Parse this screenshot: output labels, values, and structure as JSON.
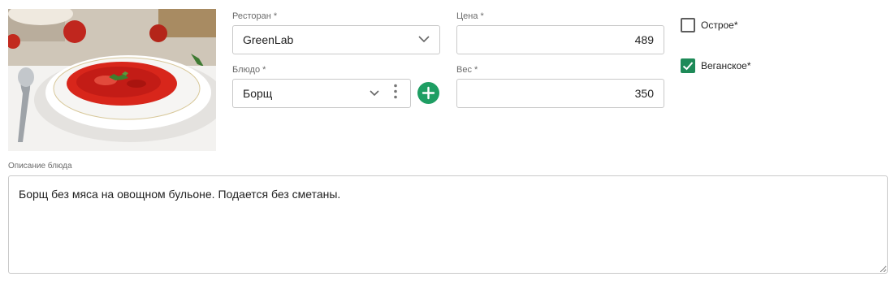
{
  "photo": {
    "alt": "Борщ"
  },
  "restaurant": {
    "label": "Ресторан *",
    "value": "GreenLab"
  },
  "dish": {
    "label": "Блюдо *",
    "value": "Борщ"
  },
  "price": {
    "label": "Цена *",
    "value": "489"
  },
  "weight": {
    "label": "Вес *",
    "value": "350"
  },
  "spicy": {
    "label": "Острое*",
    "checked": false
  },
  "vegan": {
    "label": "Веганское*",
    "checked": true
  },
  "description": {
    "label": "Описание блюда",
    "value": "Борщ без мяса на овощном бульоне. Подается без сметаны."
  },
  "colors": {
    "accent": "#1e9e63",
    "checkbox_checked": "#1e8a58",
    "border": "#c9c9c9"
  },
  "icons": [
    "chevron-down-icon",
    "kebab-menu-icon",
    "plus-circle-icon",
    "check-icon",
    "resize-grip-icon"
  ]
}
